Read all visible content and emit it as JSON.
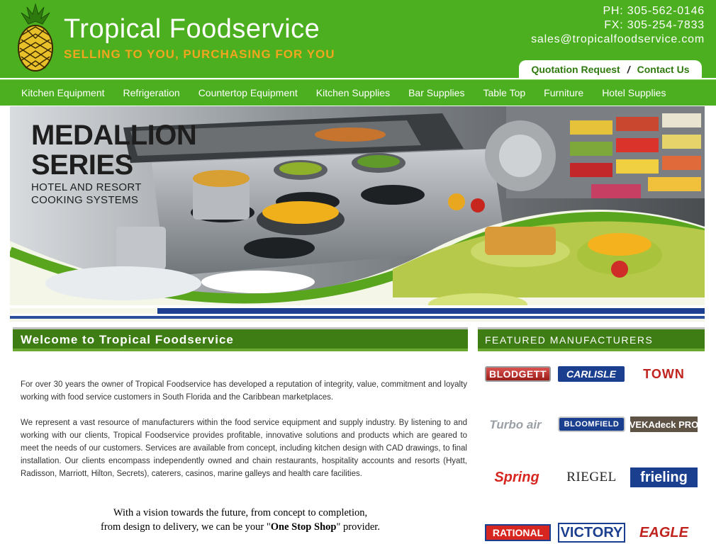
{
  "header": {
    "title": "Tropical Foodservice",
    "tagline": "SELLING TO YOU, PURCHASING FOR YOU",
    "phone": "PH: 305-562-0146",
    "fax": "FX: 305-254-7833",
    "email": "sales@tropicalfoodservice.com",
    "quick_links": {
      "quotation": "Quotation Request",
      "separator": "/",
      "contact": "Contact Us"
    },
    "logo_icon": "pineapple-icon"
  },
  "nav": {
    "items": [
      "Kitchen Equipment",
      "Refrigeration",
      "Countertop Equipment",
      "Kitchen Supplies",
      "Bar Supplies",
      "Table Top",
      "Furniture",
      "Hotel Supplies"
    ]
  },
  "banner": {
    "title_line1": "MEDALLION",
    "title_line2": "SERIES",
    "subtitle_line1": "HOTEL AND RESORT",
    "subtitle_line2": "COOKING SYSTEMS"
  },
  "welcome": {
    "heading": "Welcome to Tropical Foodservice",
    "para1": "For over 30 years the owner of Tropical Foodservice has developed a reputation of integrity, value, commitment and loyalty working with food service customers in South Florida and the Caribbean marketplaces.",
    "para2": "We represent a vast resource of manufacturers within the food service equipment and supply industry. By listening to and working with our clients, Tropical Foodservice provides profitable, innovative solutions and products which are geared to meet the needs of our customers. Services are available from concept, including kitchen design with CAD drawings, to final installation. Our clients encompass independently owned and chain restaurants, hospitality accounts and resorts (Hyatt, Radisson, Marriott, Hilton, Secrets), caterers, casinos, marine galleys and health care facilities.",
    "quote_line1": "With a vision towards the future, from concept to completion,",
    "quote_line2_before": "from design to delivery, we can be your \"",
    "quote_emphasis": "One Stop Shop",
    "quote_line2_after": "\" provider."
  },
  "manufacturers": {
    "heading": "FEATURED MANUFACTURERS",
    "logos": [
      {
        "name": "BLODGETT"
      },
      {
        "name": "CARLISLE"
      },
      {
        "name": "TOWN"
      },
      {
        "name": "Turbo air"
      },
      {
        "name": "BLOOMFIELD"
      },
      {
        "name": "VEKAdeck PRO"
      },
      {
        "name": "Spring"
      },
      {
        "name": "RIEGEL"
      },
      {
        "name": "frieling"
      },
      {
        "name": "RATIONAL"
      },
      {
        "name": "VICTORY"
      },
      {
        "name": "EAGLE"
      }
    ]
  },
  "colors": {
    "header_green": "#4caf1f",
    "dark_green": "#3e7d13",
    "tagline_orange": "#f2a51f",
    "banner_blue": "#1c3f8f"
  }
}
